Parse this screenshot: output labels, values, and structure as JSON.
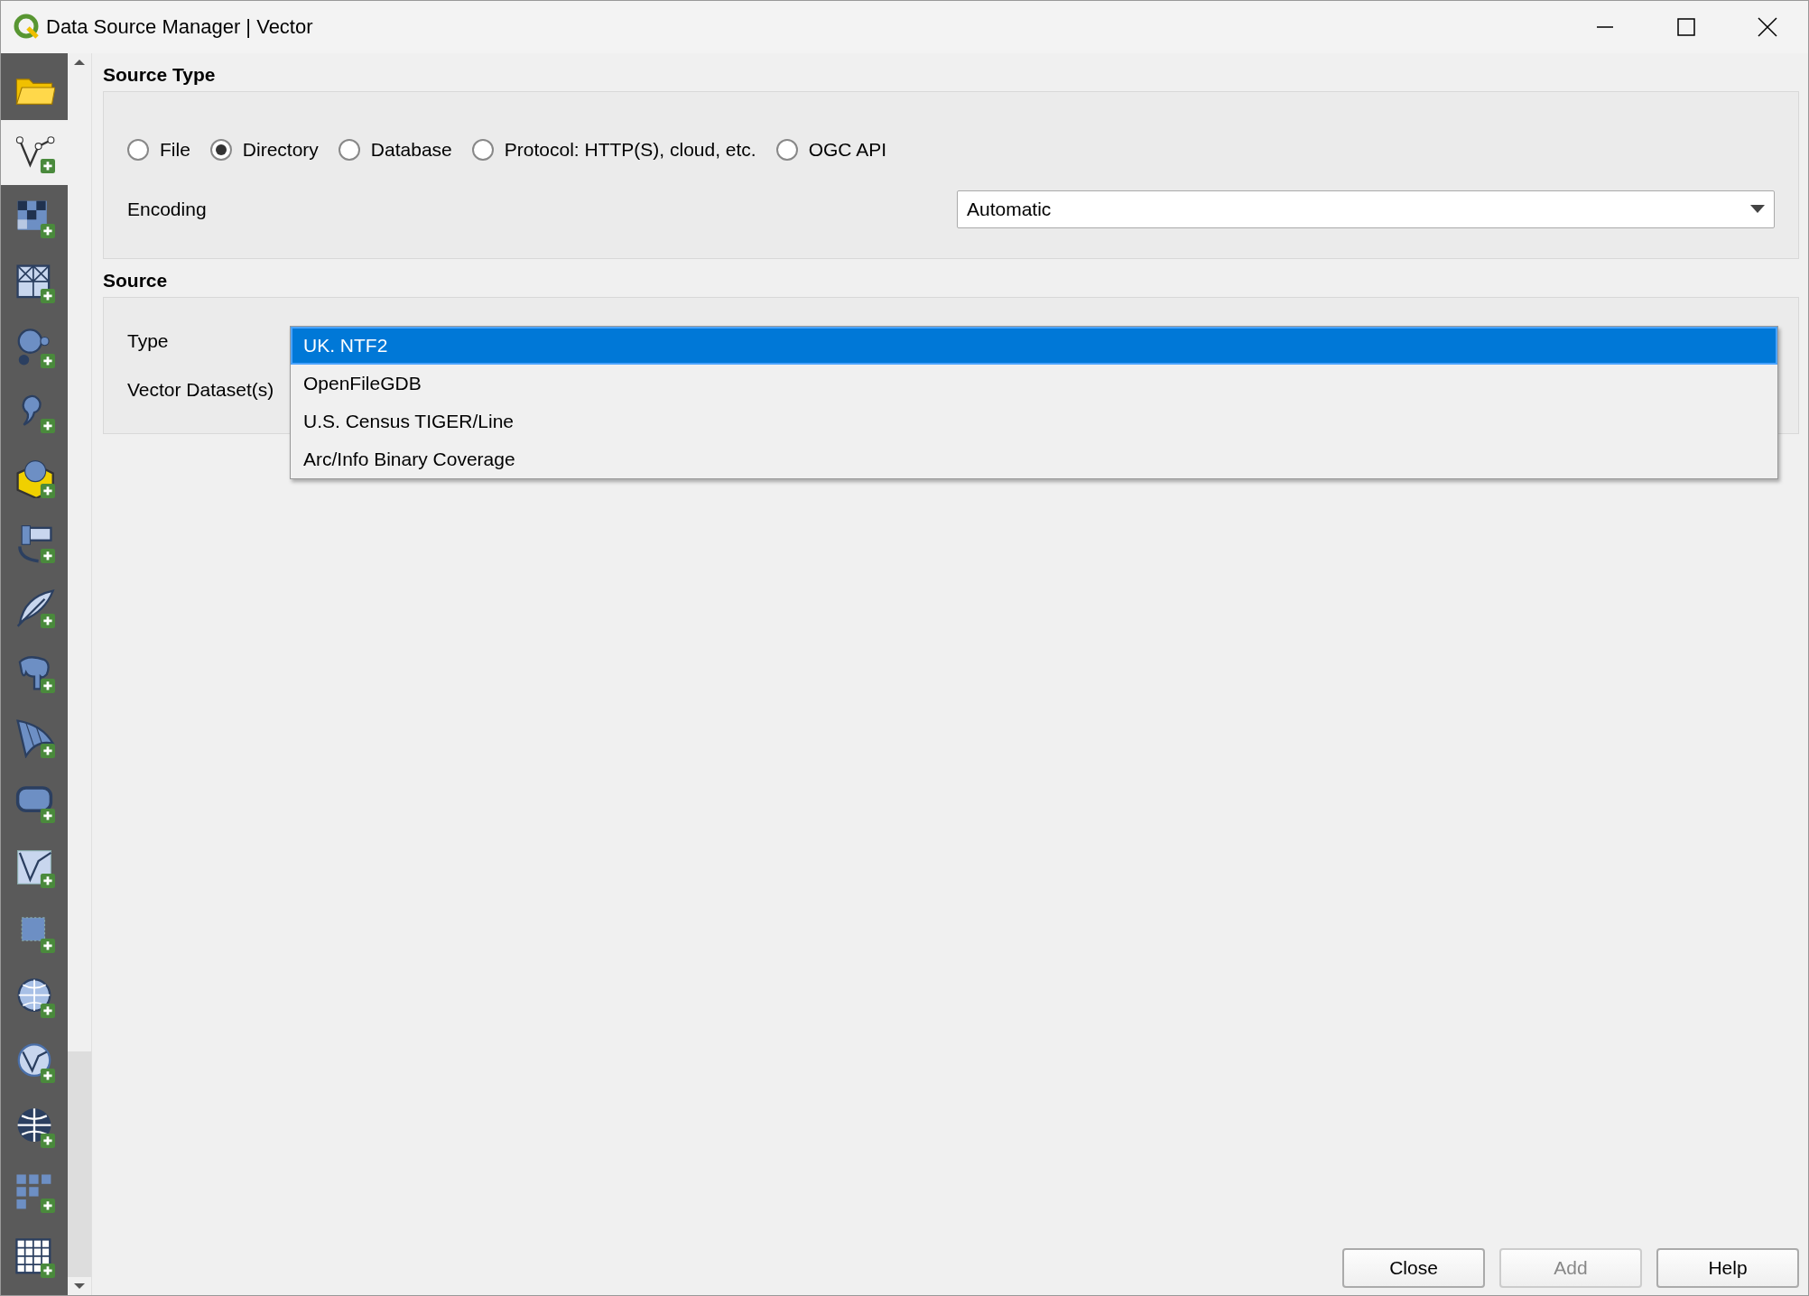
{
  "window": {
    "title": "Data Source Manager | Vector"
  },
  "sidebar": {
    "items": [
      {
        "selected": false
      },
      {
        "selected": true
      },
      {
        "selected": false
      },
      {
        "selected": false
      },
      {
        "selected": false
      },
      {
        "selected": false
      },
      {
        "selected": false
      },
      {
        "selected": false
      },
      {
        "selected": false
      },
      {
        "selected": false
      },
      {
        "selected": false
      },
      {
        "selected": false
      },
      {
        "selected": false
      },
      {
        "selected": false
      },
      {
        "selected": false
      },
      {
        "selected": false
      },
      {
        "selected": false
      },
      {
        "selected": false
      },
      {
        "selected": false
      }
    ]
  },
  "source_type": {
    "heading": "Source Type",
    "options": [
      {
        "label": "File",
        "selected": false
      },
      {
        "label": "Directory",
        "selected": true
      },
      {
        "label": "Database",
        "selected": false
      },
      {
        "label": "Protocol: HTTP(S), cloud, etc.",
        "selected": false
      },
      {
        "label": "OGC API",
        "selected": false
      }
    ],
    "encoding": {
      "label": "Encoding",
      "value": "Automatic"
    }
  },
  "source": {
    "heading": "Source",
    "type_label": "Type",
    "dataset_label": "Vector Dataset(s)",
    "type_list": [
      {
        "label": "UK. NTF2",
        "selected": true
      },
      {
        "label": "OpenFileGDB",
        "selected": false
      },
      {
        "label": "U.S. Census TIGER/Line",
        "selected": false
      },
      {
        "label": "Arc/Info Binary Coverage",
        "selected": false
      }
    ]
  },
  "buttons": [
    {
      "label": "Close",
      "disabled": false
    },
    {
      "label": "Add",
      "disabled": true
    },
    {
      "label": "Help",
      "disabled": false
    }
  ]
}
